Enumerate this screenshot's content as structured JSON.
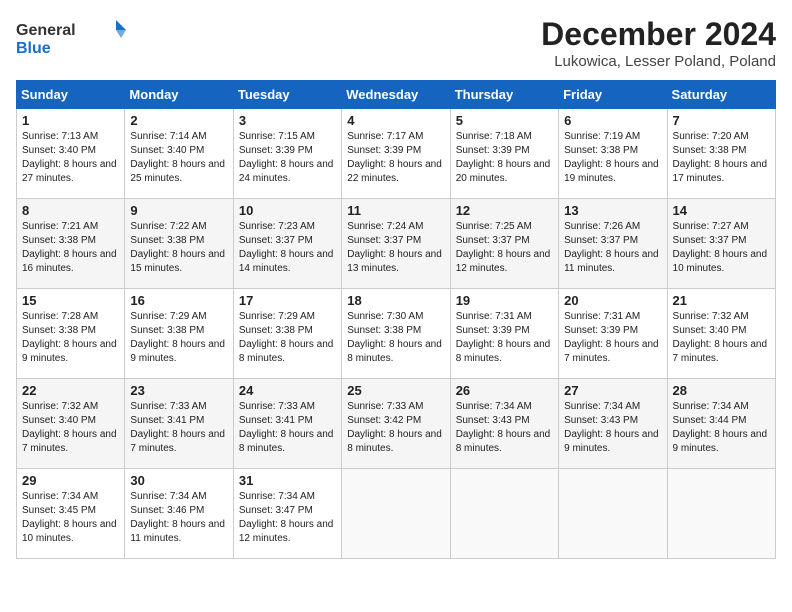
{
  "logo": {
    "general": "General",
    "blue": "Blue"
  },
  "title": "December 2024",
  "location": "Lukowica, Lesser Poland, Poland",
  "headers": [
    "Sunday",
    "Monday",
    "Tuesday",
    "Wednesday",
    "Thursday",
    "Friday",
    "Saturday"
  ],
  "weeks": [
    [
      {
        "day": "1",
        "sunrise": "7:13 AM",
        "sunset": "3:40 PM",
        "daylight": "8 hours and 27 minutes."
      },
      {
        "day": "2",
        "sunrise": "7:14 AM",
        "sunset": "3:40 PM",
        "daylight": "8 hours and 25 minutes."
      },
      {
        "day": "3",
        "sunrise": "7:15 AM",
        "sunset": "3:39 PM",
        "daylight": "8 hours and 24 minutes."
      },
      {
        "day": "4",
        "sunrise": "7:17 AM",
        "sunset": "3:39 PM",
        "daylight": "8 hours and 22 minutes."
      },
      {
        "day": "5",
        "sunrise": "7:18 AM",
        "sunset": "3:39 PM",
        "daylight": "8 hours and 20 minutes."
      },
      {
        "day": "6",
        "sunrise": "7:19 AM",
        "sunset": "3:38 PM",
        "daylight": "8 hours and 19 minutes."
      },
      {
        "day": "7",
        "sunrise": "7:20 AM",
        "sunset": "3:38 PM",
        "daylight": "8 hours and 17 minutes."
      }
    ],
    [
      {
        "day": "8",
        "sunrise": "7:21 AM",
        "sunset": "3:38 PM",
        "daylight": "8 hours and 16 minutes."
      },
      {
        "day": "9",
        "sunrise": "7:22 AM",
        "sunset": "3:38 PM",
        "daylight": "8 hours and 15 minutes."
      },
      {
        "day": "10",
        "sunrise": "7:23 AM",
        "sunset": "3:37 PM",
        "daylight": "8 hours and 14 minutes."
      },
      {
        "day": "11",
        "sunrise": "7:24 AM",
        "sunset": "3:37 PM",
        "daylight": "8 hours and 13 minutes."
      },
      {
        "day": "12",
        "sunrise": "7:25 AM",
        "sunset": "3:37 PM",
        "daylight": "8 hours and 12 minutes."
      },
      {
        "day": "13",
        "sunrise": "7:26 AM",
        "sunset": "3:37 PM",
        "daylight": "8 hours and 11 minutes."
      },
      {
        "day": "14",
        "sunrise": "7:27 AM",
        "sunset": "3:37 PM",
        "daylight": "8 hours and 10 minutes."
      }
    ],
    [
      {
        "day": "15",
        "sunrise": "7:28 AM",
        "sunset": "3:38 PM",
        "daylight": "8 hours and 9 minutes."
      },
      {
        "day": "16",
        "sunrise": "7:29 AM",
        "sunset": "3:38 PM",
        "daylight": "8 hours and 9 minutes."
      },
      {
        "day": "17",
        "sunrise": "7:29 AM",
        "sunset": "3:38 PM",
        "daylight": "8 hours and 8 minutes."
      },
      {
        "day": "18",
        "sunrise": "7:30 AM",
        "sunset": "3:38 PM",
        "daylight": "8 hours and 8 minutes."
      },
      {
        "day": "19",
        "sunrise": "7:31 AM",
        "sunset": "3:39 PM",
        "daylight": "8 hours and 8 minutes."
      },
      {
        "day": "20",
        "sunrise": "7:31 AM",
        "sunset": "3:39 PM",
        "daylight": "8 hours and 7 minutes."
      },
      {
        "day": "21",
        "sunrise": "7:32 AM",
        "sunset": "3:40 PM",
        "daylight": "8 hours and 7 minutes."
      }
    ],
    [
      {
        "day": "22",
        "sunrise": "7:32 AM",
        "sunset": "3:40 PM",
        "daylight": "8 hours and 7 minutes."
      },
      {
        "day": "23",
        "sunrise": "7:33 AM",
        "sunset": "3:41 PM",
        "daylight": "8 hours and 7 minutes."
      },
      {
        "day": "24",
        "sunrise": "7:33 AM",
        "sunset": "3:41 PM",
        "daylight": "8 hours and 8 minutes."
      },
      {
        "day": "25",
        "sunrise": "7:33 AM",
        "sunset": "3:42 PM",
        "daylight": "8 hours and 8 minutes."
      },
      {
        "day": "26",
        "sunrise": "7:34 AM",
        "sunset": "3:43 PM",
        "daylight": "8 hours and 8 minutes."
      },
      {
        "day": "27",
        "sunrise": "7:34 AM",
        "sunset": "3:43 PM",
        "daylight": "8 hours and 9 minutes."
      },
      {
        "day": "28",
        "sunrise": "7:34 AM",
        "sunset": "3:44 PM",
        "daylight": "8 hours and 9 minutes."
      }
    ],
    [
      {
        "day": "29",
        "sunrise": "7:34 AM",
        "sunset": "3:45 PM",
        "daylight": "8 hours and 10 minutes."
      },
      {
        "day": "30",
        "sunrise": "7:34 AM",
        "sunset": "3:46 PM",
        "daylight": "8 hours and 11 minutes."
      },
      {
        "day": "31",
        "sunrise": "7:34 AM",
        "sunset": "3:47 PM",
        "daylight": "8 hours and 12 minutes."
      },
      null,
      null,
      null,
      null
    ]
  ]
}
